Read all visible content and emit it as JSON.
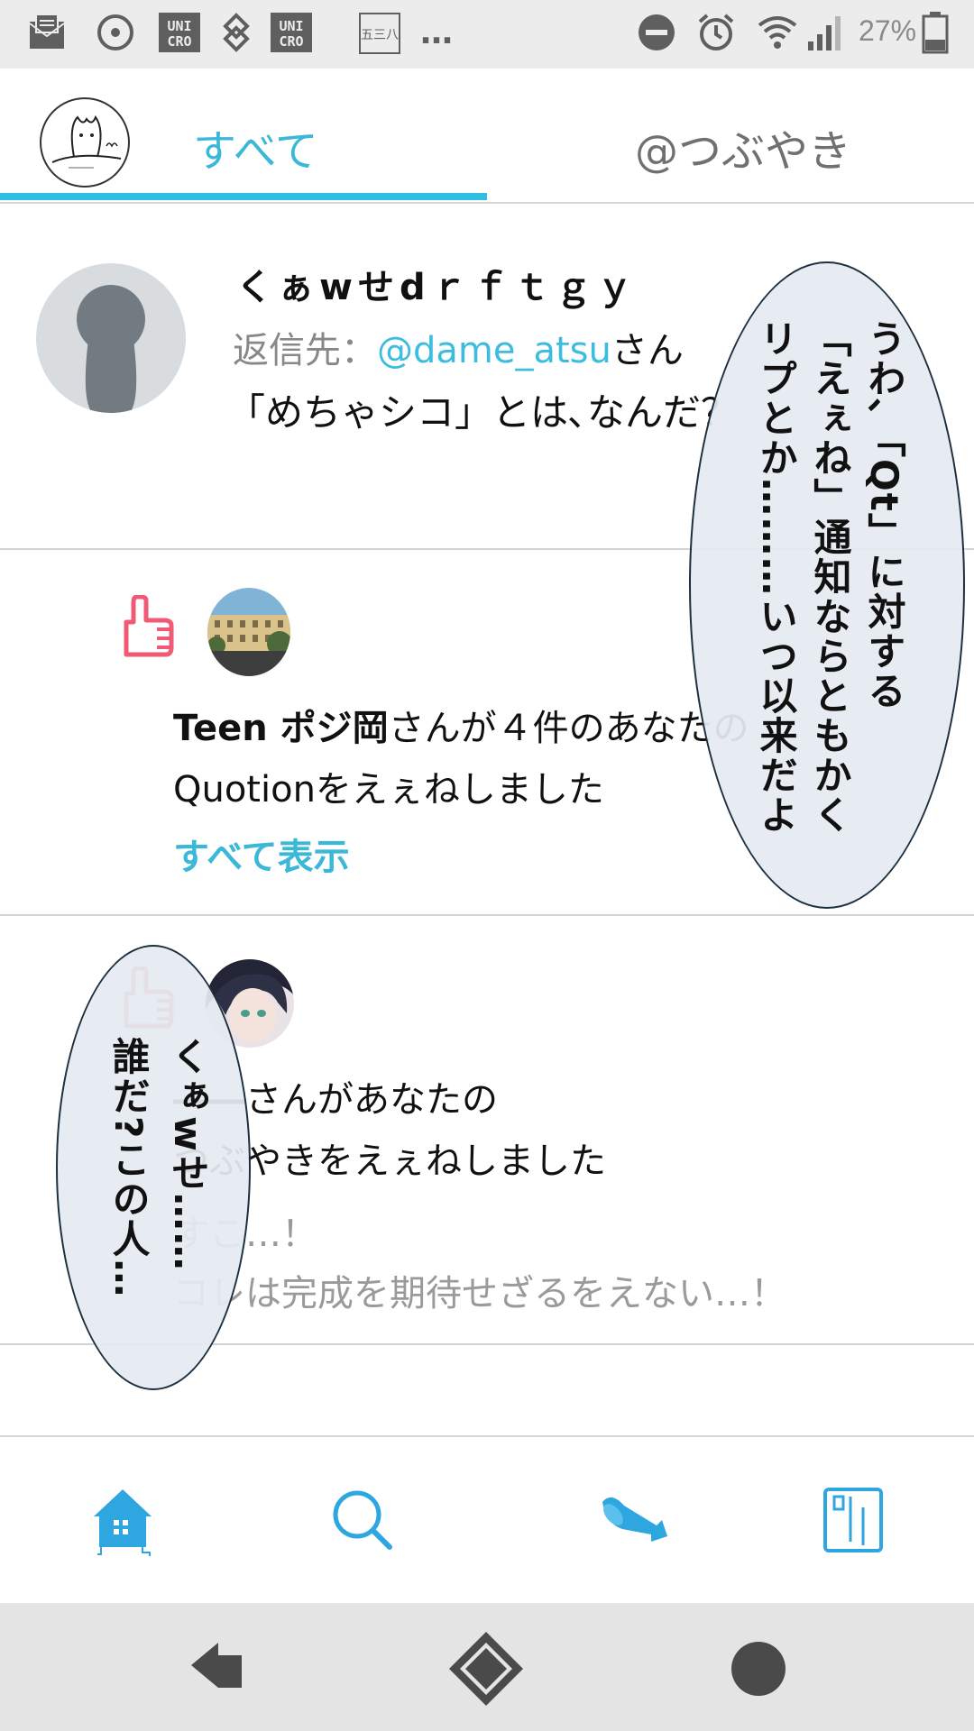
{
  "status_bar": {
    "icons": [
      "mail-icon",
      "disc-icon",
      "uniqlo-logo-icon",
      "diamond-link-icon",
      "uniqlo-logo-icon",
      "kanji-app-icon",
      "more-dots-icon",
      "dnd-icon",
      "alarm-icon",
      "wifi-icon",
      "signal-icon",
      "battery-icon"
    ],
    "uniqlo_1": "UNI CRO",
    "uniqlo_2": "UNI CRO",
    "kanji_badge": "五三八",
    "more": "…",
    "battery_percent": "27%"
  },
  "tabs": {
    "all": "すべて",
    "tsubuyaki": "@つぶやき",
    "active": "all"
  },
  "reply_item": {
    "user_name": "くぁwせdｒｆｔｇｙ",
    "reply_prefix": "返信先：",
    "reply_to": "@dame_atsu",
    "reply_suffix": "さん",
    "body": "「めちゃシコ」とは､なんだ？"
  },
  "like_notification": {
    "actor": "Teen ポジ岡",
    "line1_rest": "さんが４件のあなたの",
    "line2": "Quotionをえぇねしました",
    "show_all": "すべて表示"
  },
  "like_notification_2": {
    "actor_hidden": "――",
    "line1_rest": "さんがあなたの",
    "line2": "つぶやきをえぇねしました",
    "snippet_1": "すこ…！",
    "snippet_2": "コレは完成を期待せざるをえない…！"
  },
  "speech_bubbles": {
    "right": [
      "うわ､「Qt」に対する",
      "「えぇね」通知ならともかく",
      "リプとか………いつ以来だよ"
    ],
    "left": [
      "くぁwせ……",
      "誰だ?この人…"
    ]
  },
  "bottom_nav": {
    "icons": [
      "home-icon",
      "search-icon",
      "megaphone-icon",
      "panel-icon"
    ],
    "accent": "#2ea7e0"
  },
  "colors": {
    "accent_blue": "#3bb8d8",
    "like_pink": "#f05a74"
  }
}
